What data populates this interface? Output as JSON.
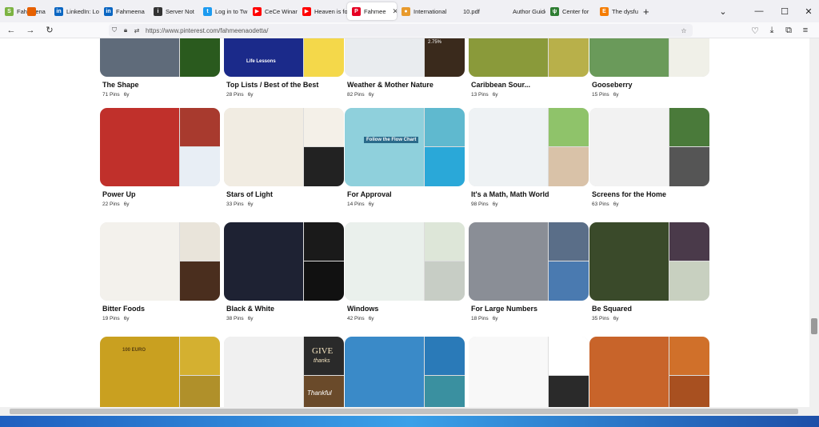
{
  "tabs": [
    {
      "label": "",
      "color": "#e66000",
      "glyph": "",
      "width": 22
    },
    {
      "label": "Fahmeena",
      "color": "#7cb342",
      "glyph": "S",
      "width": 62
    },
    {
      "label": "LinkedIn: Lo",
      "color": "#0a66c2",
      "glyph": "in",
      "width": 62
    },
    {
      "label": "Fahmeena",
      "color": "#0a66c2",
      "glyph": "in",
      "width": 62
    },
    {
      "label": "Server Not",
      "color": "#333333",
      "glyph": "i",
      "width": 62
    },
    {
      "label": "Log in to Tw",
      "color": "#1d9bf0",
      "glyph": "t",
      "width": 62
    },
    {
      "label": "CeCe Winans",
      "color": "#ff0000",
      "glyph": "▶",
      "width": 62
    },
    {
      "label": "Heaven is fo",
      "color": "#ff0000",
      "glyph": "▶",
      "width": 62
    },
    {
      "label": "Fahmee",
      "color": "#e60023",
      "glyph": "P",
      "width": 62,
      "active": true
    },
    {
      "label": "International",
      "color": "#e89a2c",
      "glyph": "●",
      "width": 62
    },
    {
      "label": "10.pdf",
      "color": "",
      "glyph": "",
      "width": 62
    },
    {
      "label": "Author Guideline",
      "color": "",
      "glyph": "",
      "width": 62
    },
    {
      "label": "Center for",
      "color": "#2e7d32",
      "glyph": "ψ",
      "width": 62
    },
    {
      "label": "The dysfun",
      "color": "#f57c00",
      "glyph": "E",
      "width": 54
    }
  ],
  "new_tab_icon": "plus-icon",
  "url": "https://www.pinterest.com/fahmeenaodetta/",
  "boards": [
    {
      "name": "The Shape",
      "pins": "71 Pins",
      "age": "6y",
      "colors": [
        "#5f6b7a",
        "#8a3b2e",
        "#2a5a1e"
      ]
    },
    {
      "name": "Top Lists / Best of the Best",
      "pins": "28 Pins",
      "age": "6y",
      "colors": [
        "#1b2a8a",
        "#f2c200",
        "#f4d84a"
      ]
    },
    {
      "name": "Weather & Mother Nature",
      "pins": "82 Pins",
      "age": "6y",
      "colors": [
        "#e9ecef",
        "#2d6fb5",
        "#3a2a1c"
      ]
    },
    {
      "name": "Caribbean Sour...",
      "pins": "13 Pins",
      "age": "6y",
      "colors": [
        "#8a9a3a",
        "#c9c94a",
        "#b8b04a"
      ]
    },
    {
      "name": "Gooseberry",
      "pins": "15 Pins",
      "age": "6y",
      "colors": [
        "#6a9a5a",
        "#d8d4c0",
        "#f0f0e8"
      ]
    },
    {
      "name": "Power Up",
      "pins": "22 Pins",
      "age": "6y",
      "colors": [
        "#c0302b",
        "#a83a2e",
        "#e8eef5"
      ]
    },
    {
      "name": "Stars of Light",
      "pins": "33 Pins",
      "age": "6y",
      "colors": [
        "#f1ece2",
        "#f4f0e8",
        "#222222"
      ]
    },
    {
      "name": "For Approval",
      "pins": "14 Pins",
      "age": "6y",
      "colors": [
        "#8fd0dc",
        "#5fb9cf",
        "#2aa8d8"
      ]
    },
    {
      "name": "It's a Math, Math World",
      "pins": "98 Pins",
      "age": "6y",
      "colors": [
        "#eef2f4",
        "#8fc36a",
        "#d9c2a8"
      ]
    },
    {
      "name": "Screens for the Home",
      "pins": "63 Pins",
      "age": "6y",
      "colors": [
        "#f2f2f2",
        "#4a7a3a",
        "#555555"
      ]
    },
    {
      "name": "Bitter Foods",
      "pins": "19 Pins",
      "age": "6y",
      "colors": [
        "#f3f1ec",
        "#e9e4da",
        "#4a2e1e"
      ]
    },
    {
      "name": "Black & White",
      "pins": "38 Pins",
      "age": "6y",
      "colors": [
        "#1e2233",
        "#1a1a1a",
        "#111111"
      ]
    },
    {
      "name": "Windows",
      "pins": "42 Pins",
      "age": "6y",
      "colors": [
        "#eaf0ec",
        "#dde6d8",
        "#c7cdc5"
      ]
    },
    {
      "name": "For Large Numbers",
      "pins": "18 Pins",
      "age": "6y",
      "colors": [
        "#8a8e96",
        "#5a6e88",
        "#4a7ab0"
      ]
    },
    {
      "name": "Be Squared",
      "pins": "35 Pins",
      "age": "6y",
      "colors": [
        "#3a4a2a",
        "#4a3a4a",
        "#c8d0c0"
      ]
    },
    {
      "name": "",
      "pins": "",
      "age": "",
      "colors": [
        "#c9a020",
        "#d4b030",
        "#b0902a"
      ]
    },
    {
      "name": "",
      "pins": "",
      "age": "",
      "colors": [
        "#f0f0f0",
        "#2a2a2a",
        "#6a4a2a"
      ]
    },
    {
      "name": "",
      "pins": "",
      "age": "",
      "colors": [
        "#3a8ac8",
        "#2a7ab8",
        "#3a90a0"
      ]
    },
    {
      "name": "",
      "pins": "",
      "age": "",
      "colors": [
        "#f8f8f8",
        "#ffffff",
        "#2a2a2a"
      ]
    },
    {
      "name": "",
      "pins": "",
      "age": "",
      "colors": [
        "#c8642a",
        "#d0702a",
        "#a85020"
      ]
    }
  ],
  "cover_texts": {
    "life_lessons": "Life Lessons",
    "flow_chart": "Follow the Flow Chart",
    "give_thanks_1": "GIVE",
    "give_thanks_2": "thanks",
    "thankful": "Thankful",
    "coin_text": "100 EURO",
    "stat": "2.75%"
  }
}
